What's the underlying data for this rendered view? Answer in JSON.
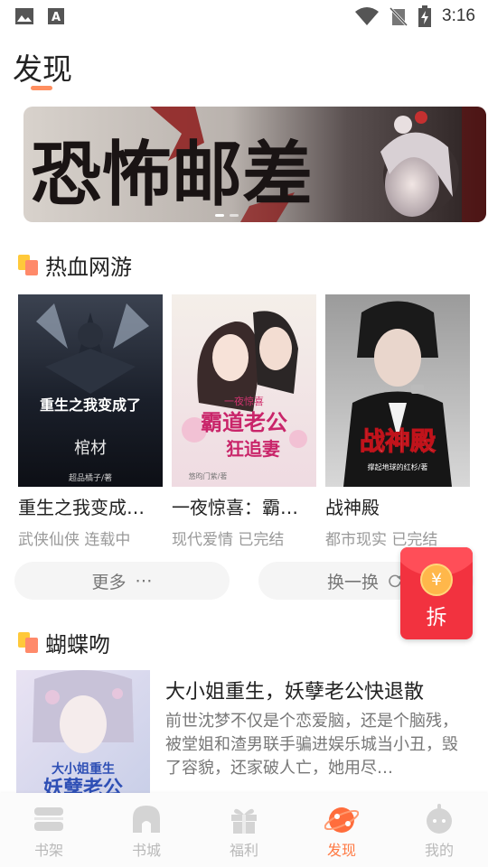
{
  "status_bar": {
    "time": "3:16"
  },
  "page": {
    "title": "发现"
  },
  "banner": {
    "art_text": "恐怖邮差"
  },
  "section1": {
    "title": "热血网游",
    "books": [
      {
        "title": "重生之我变成…",
        "genre": "武侠仙侠",
        "status": "连载中",
        "cover_title": "重生之我变成了",
        "cover_subtitle": "棺材",
        "cover_author": "超品橘子/著"
      },
      {
        "title": "一夜惊喜：霸…",
        "genre": "现代爱情",
        "status": "已完结",
        "cover_title": "霸道老公",
        "cover_subtitle": "狂追妻",
        "cover_tag": "一夜惊喜",
        "cover_author": "悠昀门紫/著"
      },
      {
        "title": "战神殿",
        "genre": "都市现实",
        "status": "已完结",
        "cover_title": "战神殿",
        "cover_author": "撑起地球的红杉/著"
      }
    ],
    "more_label": "更多",
    "more_icon": "⋯",
    "swap_label": "换一换"
  },
  "redpack": {
    "label": "拆",
    "coin": "¥"
  },
  "section2": {
    "title": "蝴蝶吻",
    "book": {
      "title": "大小姐重生，妖孽老公快退散",
      "description": "前世沈梦不仅是个恋爱脑，还是个脑残，被堂姐和渣男联手骗进娱乐城当小丑，毁了容貌，还家破人亡，她用尽…",
      "cover_title": "大小姐重生",
      "cover_subtitle": "妖孽老公"
    }
  },
  "bottom_nav": [
    {
      "label": "书架",
      "icon": "bookshelf-icon",
      "active": false
    },
    {
      "label": "书城",
      "icon": "bookstore-icon",
      "active": false
    },
    {
      "label": "福利",
      "icon": "gift-icon",
      "active": false
    },
    {
      "label": "发现",
      "icon": "discover-icon",
      "active": true
    },
    {
      "label": "我的",
      "icon": "profile-icon",
      "active": false
    }
  ],
  "colors": {
    "accent": "#ff7a44",
    "underline": "#ff8f60",
    "redpack": "#f2323f",
    "nav_inactive": "#b9b9b9"
  }
}
